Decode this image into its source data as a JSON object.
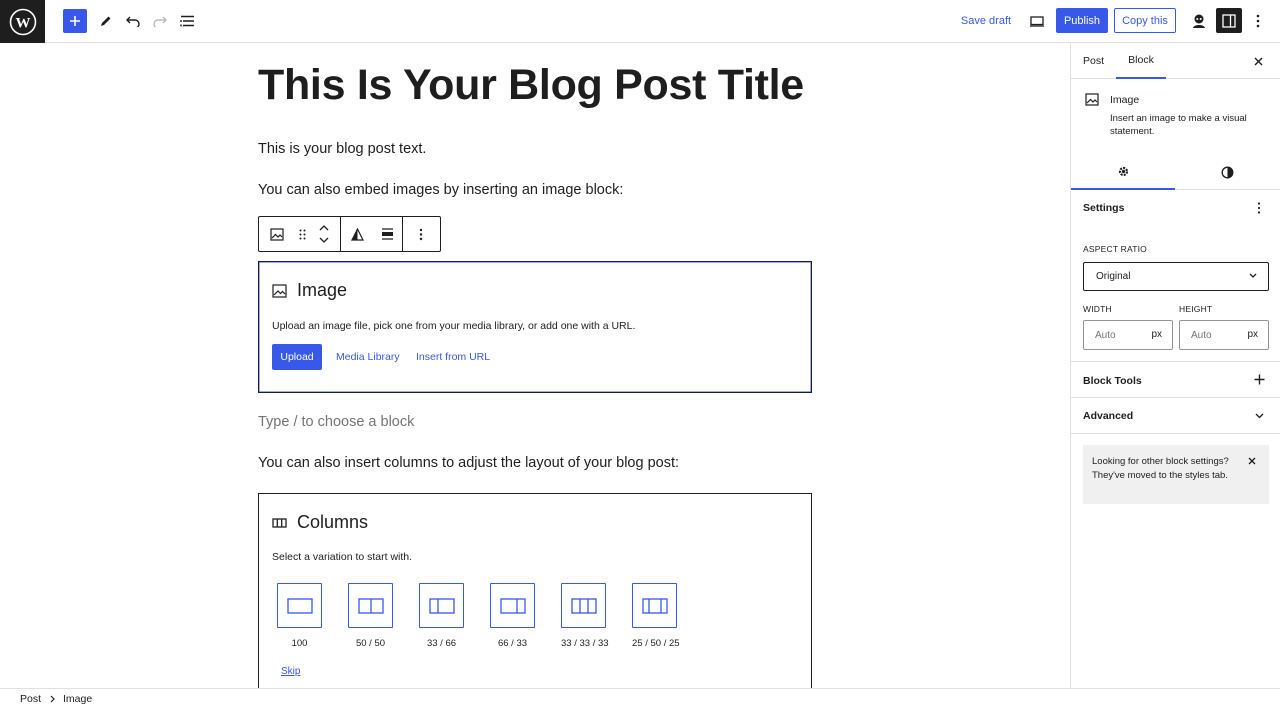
{
  "topbar": {
    "save_draft": "Save draft",
    "publish": "Publish",
    "copy_this": "Copy this"
  },
  "post": {
    "title": "This Is Your Blog Post Title",
    "paragraph_1": "This is your blog post text.",
    "paragraph_2": "You can also embed images by inserting an image block:",
    "empty_block_placeholder": "Type / to choose a block",
    "paragraph_3": "You can also insert columns to adjust the layout of your blog post:"
  },
  "image_block": {
    "title": "Image",
    "description": "Upload an image file, pick one from your media library, or add one with a URL.",
    "upload": "Upload",
    "media_library": "Media Library",
    "insert_from_url": "Insert from URL"
  },
  "columns_block": {
    "title": "Columns",
    "description": "Select a variation to start with.",
    "variations": [
      {
        "label": "100",
        "icon": "columns-100-icon"
      },
      {
        "label": "50 / 50",
        "icon": "columns-50-50-icon"
      },
      {
        "label": "33 / 66",
        "icon": "columns-33-66-icon"
      },
      {
        "label": "66 / 33",
        "icon": "columns-66-33-icon"
      },
      {
        "label": "33 / 33 / 33",
        "icon": "columns-33-33-33-icon"
      },
      {
        "label": "25 / 50 / 25",
        "icon": "columns-25-50-25-icon"
      }
    ],
    "skip": "Skip"
  },
  "sidebar": {
    "tabs": [
      "Post",
      "Block"
    ],
    "active_tab": "Block",
    "block_name": "Image",
    "block_description": "Insert an image to make a visual statement.",
    "settings_title": "Settings",
    "aspect_ratio_label": "ASPECT RATIO",
    "aspect_ratio_value": "Original",
    "width_label": "WIDTH",
    "height_label": "HEIGHT",
    "width_placeholder": "Auto",
    "height_placeholder": "Auto",
    "unit": "px",
    "block_tools": "Block Tools",
    "advanced": "Advanced",
    "notice": "Looking for other block settings? They've moved to the styles tab."
  },
  "breadcrumb": [
    "Post",
    "Image"
  ],
  "colors": {
    "accent": "#3858e9",
    "dark": "#1e1e1e",
    "border": "#e0e0e0"
  }
}
